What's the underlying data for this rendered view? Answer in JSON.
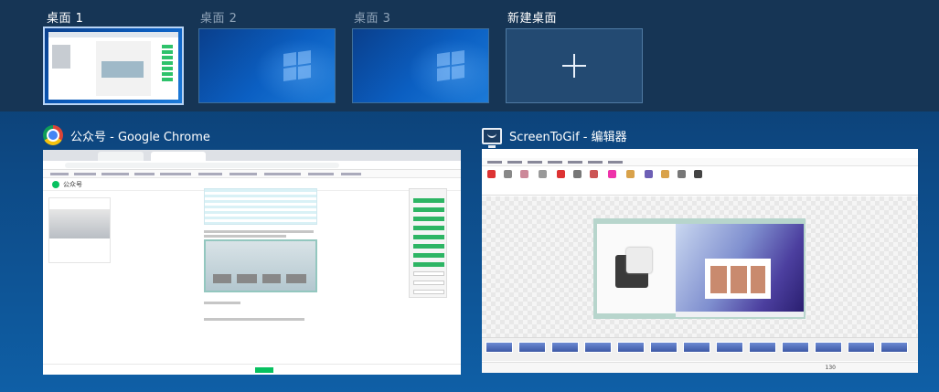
{
  "desktops": [
    {
      "label": "桌面 1",
      "active": true
    },
    {
      "label": "桌面 2",
      "active": false
    },
    {
      "label": "桌面 3",
      "active": false
    },
    {
      "label": "新建桌面",
      "active": false
    }
  ],
  "windows": {
    "chrome": {
      "title": "公众号 - Google Chrome",
      "icon": "chrome-icon",
      "page_brand": "公众号"
    },
    "screentogif": {
      "title": "ScreenToGif - 编辑器",
      "icon": "screentogif-icon",
      "status_text": "130"
    }
  },
  "colors": {
    "desktop_strip": "#163555",
    "background": "#0d4a86",
    "active_border": "#b8d4f5",
    "wechat_green": "#07c160"
  }
}
